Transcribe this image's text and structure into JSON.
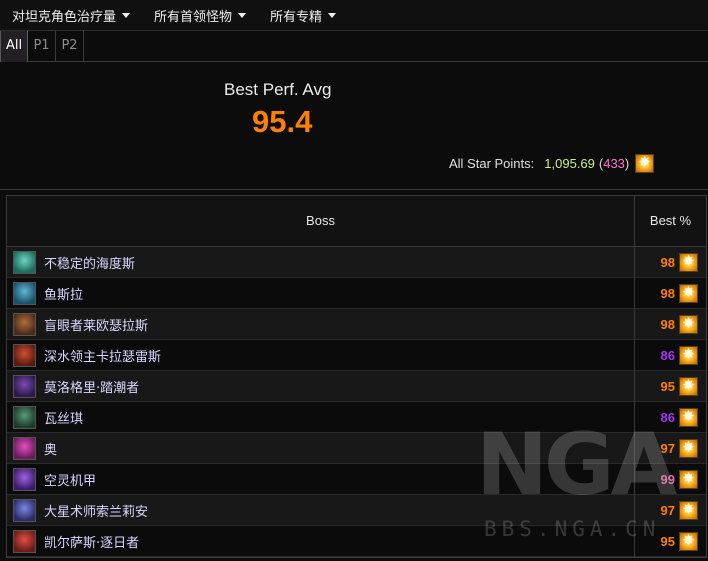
{
  "menus": [
    {
      "label": "对坦克角色治疗量"
    },
    {
      "label": "所有首领怪物"
    },
    {
      "label": "所有专精"
    }
  ],
  "tabs": [
    {
      "label": "All",
      "active": true
    },
    {
      "label": "P1",
      "active": false
    },
    {
      "label": "P2",
      "active": false
    }
  ],
  "summary": {
    "best_label": "Best Perf. Avg",
    "best_value": "95.4",
    "points_label": "All Star Points:",
    "points_value": "1,095.69",
    "points_rank": "433",
    "open_paren": "(",
    "close_paren": ")"
  },
  "table": {
    "headers": {
      "boss": "Boss",
      "best": "Best %"
    },
    "rows": [
      {
        "name": "不稳定的海度斯",
        "score": "98",
        "score_color": "#ff8000",
        "avatar_colors": [
          "#1b6a5a",
          "#6fd6c2"
        ]
      },
      {
        "name": "鱼斯拉",
        "score": "98",
        "score_color": "#ff8000",
        "avatar_colors": [
          "#1a4f6a",
          "#5fb8d6"
        ]
      },
      {
        "name": "盲眼者莱欧瑟拉斯",
        "score": "98",
        "score_color": "#ff8000",
        "avatar_colors": [
          "#4a2a1a",
          "#b06c3a"
        ]
      },
      {
        "name": "深水领主卡拉瑟雷斯",
        "score": "86",
        "score_color": "#a335ee",
        "avatar_colors": [
          "#5a1a10",
          "#d05030"
        ]
      },
      {
        "name": "莫洛格里·踏潮者",
        "score": "95",
        "score_color": "#ff8000",
        "avatar_colors": [
          "#2a1a4a",
          "#7a4ab0"
        ]
      },
      {
        "name": "瓦丝琪",
        "score": "86",
        "score_color": "#a335ee",
        "avatar_colors": [
          "#1a3a2a",
          "#5a9a7a"
        ]
      },
      {
        "name": "奥",
        "score": "97",
        "score_color": "#ff8000",
        "avatar_colors": [
          "#6a1a5a",
          "#e050c0"
        ]
      },
      {
        "name": "空灵机甲",
        "score": "99",
        "score_color": "#e268a8",
        "avatar_colors": [
          "#3a1a6a",
          "#a060e0"
        ]
      },
      {
        "name": "大星术师索兰莉安",
        "score": "97",
        "score_color": "#ff8000",
        "avatar_colors": [
          "#2a2a6a",
          "#7a8ae0"
        ]
      },
      {
        "name": "凯尔萨斯·逐日者",
        "score": "95",
        "score_color": "#ff8000",
        "avatar_colors": [
          "#6a1a1a",
          "#e05040"
        ]
      }
    ]
  },
  "watermark": {
    "logo": "NGA",
    "site": "BBS.NGA.CN"
  },
  "icons": {
    "dropdown": "caret-down-icon",
    "star": "star-burst-icon"
  }
}
